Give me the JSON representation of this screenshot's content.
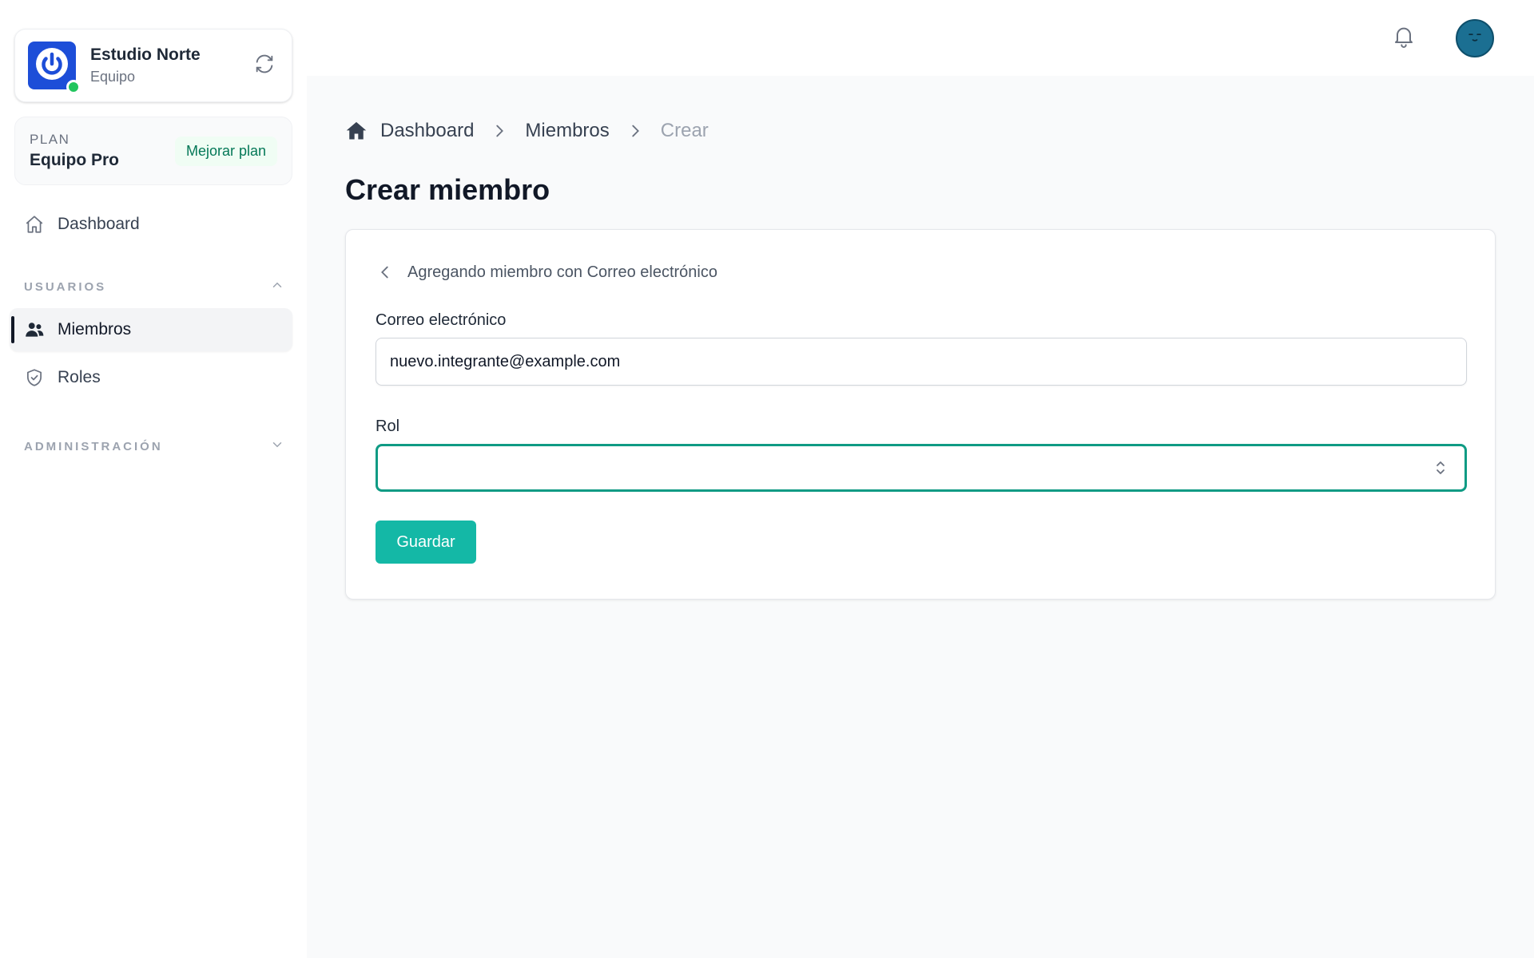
{
  "team": {
    "name": "Estudio Norte",
    "type": "Equipo",
    "logo_icon": "power-icon",
    "status_color": "#22c55e"
  },
  "plan": {
    "label": "PLAN",
    "name": "Equipo Pro",
    "upgrade_label": "Mejorar plan"
  },
  "sidebar": {
    "dashboard_label": "Dashboard",
    "sections": {
      "usuarios": {
        "title": "USUARIOS",
        "expanded": true
      },
      "administracion": {
        "title": "ADMINISTRACIÓN",
        "expanded": false
      }
    },
    "items": {
      "miembros": {
        "label": "Miembros",
        "active": true
      },
      "roles": {
        "label": "Roles",
        "active": false
      }
    }
  },
  "topbar": {
    "notifications_icon": "bell-icon",
    "avatar_color": "#1b6f92"
  },
  "breadcrumb": {
    "items": [
      "Dashboard",
      "Miembros",
      "Crear"
    ]
  },
  "page": {
    "title": "Crear miembro"
  },
  "form": {
    "back_text": "Agregando miembro con Correo electrónico",
    "email_label": "Correo electrónico",
    "email_value": "nuevo.integrante@example.com",
    "role_label": "Rol",
    "role_value": "",
    "save_label": "Guardar"
  },
  "colors": {
    "accent": "#14b8a6",
    "focus_border": "#0f9b84",
    "brand_blue": "#1d4ed8"
  }
}
